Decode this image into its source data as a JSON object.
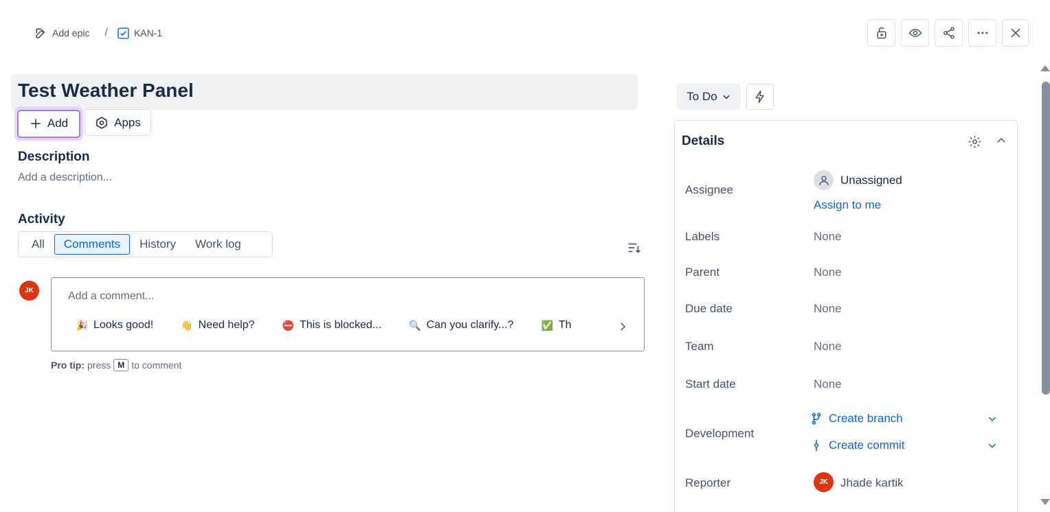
{
  "breadcrumb": {
    "epic": "Add epic",
    "separator": "/",
    "issue_key": "KAN-1"
  },
  "issue": {
    "title": "Test Weather Panel"
  },
  "toolbar": {
    "add_label": "Add",
    "apps_label": "Apps"
  },
  "description": {
    "heading": "Description",
    "placeholder": "Add a description..."
  },
  "activity": {
    "heading": "Activity",
    "tabs": [
      {
        "label": "All"
      },
      {
        "label": "Comments"
      },
      {
        "label": "History"
      },
      {
        "label": "Work log"
      }
    ],
    "active_tab": "Comments"
  },
  "comment": {
    "avatar_initials": "JK",
    "placeholder": "Add a comment...",
    "quick_replies": [
      {
        "emoji": "🎉",
        "label": "Looks good!"
      },
      {
        "emoji": "👋",
        "label": "Need help?"
      },
      {
        "emoji": "⛔",
        "label": "This is blocked..."
      },
      {
        "emoji": "🔍",
        "label": "Can you clarify...?"
      },
      {
        "emoji": "✅",
        "label": "Th"
      }
    ],
    "protip": {
      "prefix": "Pro tip:",
      "press": "press",
      "key": "M",
      "suffix": "to comment"
    }
  },
  "status": {
    "label": "To Do"
  },
  "details": {
    "title": "Details",
    "assignee": {
      "label": "Assignee",
      "value": "Unassigned",
      "assign_link": "Assign to me"
    },
    "labels": {
      "label": "Labels",
      "value": "None"
    },
    "parent": {
      "label": "Parent",
      "value": "None"
    },
    "due_date": {
      "label": "Due date",
      "value": "None"
    },
    "team": {
      "label": "Team",
      "value": "None"
    },
    "start_date": {
      "label": "Start date",
      "value": "None"
    },
    "development": {
      "label": "Development",
      "create_branch": "Create branch",
      "create_commit": "Create commit"
    },
    "reporter": {
      "label": "Reporter",
      "value": "Jhade kartik",
      "initials": "JK"
    }
  },
  "colors": {
    "accent": "#0c66e4",
    "focus": "#a37ae6",
    "avatar": "#de350b"
  }
}
